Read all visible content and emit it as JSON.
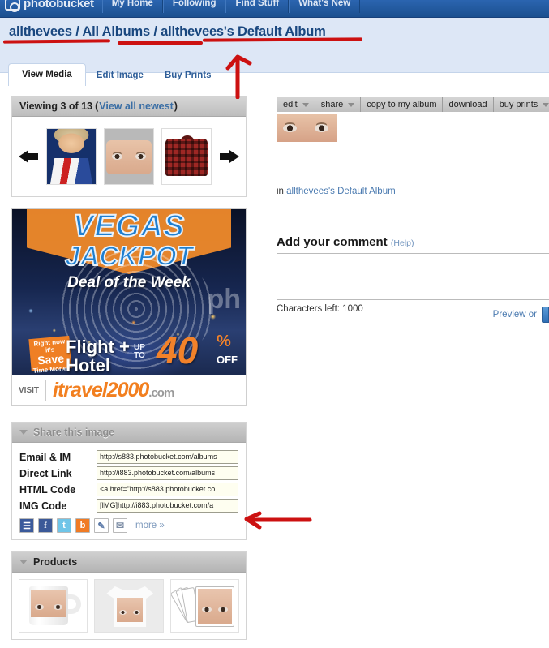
{
  "site": {
    "brand": "photobucket",
    "logo_icon": "photobucket-camera-icon",
    "nav": [
      {
        "label": "My Home"
      },
      {
        "label": "Following"
      },
      {
        "label": "Find Stuff"
      },
      {
        "label": "What's New"
      }
    ]
  },
  "breadcrumb": {
    "user": "allthevees",
    "sep": "/",
    "all_albums": "All Albums",
    "album": "allthevees's Default Album"
  },
  "tabs": [
    {
      "label": "View Media",
      "active": true
    },
    {
      "label": "Edit Image",
      "active": false
    },
    {
      "label": "Buy Prints",
      "active": false
    }
  ],
  "viewer": {
    "title_prefix": "Viewing 3 of 13",
    "title_paren_open": "(",
    "view_all_newest": "View all newest",
    "title_paren_close": ")",
    "current_index": 3,
    "total": 13,
    "prev_icon": "arrow-left-icon",
    "next_icon": "arrow-right-icon",
    "thumbs": [
      {
        "alt": "man in white jumpsuit portrait"
      },
      {
        "alt": "close up of eyes"
      },
      {
        "alt": "red plaid flannel shirt"
      }
    ]
  },
  "ad": {
    "headline_1": "VEGAS",
    "headline_2": "JACKPOT",
    "subhead": "Deal of the Week",
    "offer_line_1": "Flight +",
    "offer_line_2": "Hotel",
    "upto_1": "UP",
    "upto_2": "TO",
    "discount": "40",
    "percent": "%",
    "off": "OFF",
    "save_small": "Right now it's",
    "save_big": "Save",
    "save_sub": "Time Money",
    "visit": "VISIT",
    "brand": "itravel2000",
    "brand_tld": ".com",
    "watermark": "ph"
  },
  "share": {
    "panel_title": "Share this image",
    "collapse_icon": "triangle-down-icon",
    "rows": [
      {
        "label": "Email & IM",
        "value": "http://s883.photobucket.com/albums"
      },
      {
        "label": "Direct Link",
        "value": "http://i883.photobucket.com/albums"
      },
      {
        "label": "HTML Code",
        "value": "<a href=\"http://s883.photobucket.co"
      },
      {
        "label": "IMG Code",
        "value": "[IMG]http://i883.photobucket.com/a"
      }
    ],
    "icons": [
      {
        "name": "myspace-icon",
        "glyph": "\u0000"
      },
      {
        "name": "facebook-icon",
        "glyph": "f"
      },
      {
        "name": "twitter-icon",
        "glyph": "t"
      },
      {
        "name": "blogger-icon",
        "glyph": "b"
      },
      {
        "name": "tag-link-icon",
        "glyph": "✎"
      },
      {
        "name": "email-icon",
        "glyph": "✉"
      }
    ],
    "more_label": "more »"
  },
  "products": {
    "panel_title": "Products",
    "collapse_icon": "triangle-down-icon",
    "items": [
      {
        "alt": "photo mug"
      },
      {
        "alt": "photo t-shirt"
      },
      {
        "alt": "photo playing cards"
      }
    ]
  },
  "image_toolbar": [
    {
      "label": "edit",
      "has_caret": true
    },
    {
      "label": "share",
      "has_caret": true
    },
    {
      "label": "copy to my album",
      "has_caret": false
    },
    {
      "label": "download",
      "has_caret": false
    },
    {
      "label": "buy prints",
      "has_caret": true
    }
  ],
  "image_meta": {
    "in_label": "in",
    "album_link": "allthevees's Default Album"
  },
  "comment": {
    "heading": "Add your comment",
    "help": "(Help)",
    "textarea_value": "",
    "textarea_placeholder": "",
    "chars_left": "Characters left: 1000",
    "preview_label": "Preview or",
    "submit_label": ""
  },
  "colors": {
    "navbar": "#1f5bac",
    "header_band": "#dde7f6",
    "breadcrumb_text": "#19477f",
    "link": "#4a7ab0",
    "annotation_red": "#cc1111",
    "panel_head": "#c6c6c6",
    "input_bg": "#fefef0"
  }
}
